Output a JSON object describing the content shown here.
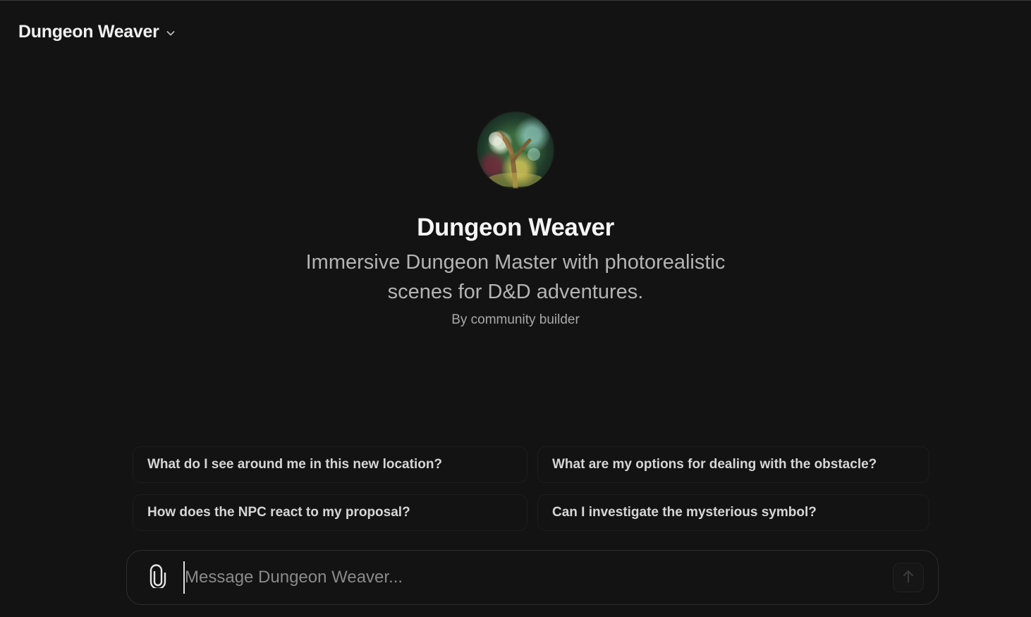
{
  "header": {
    "title": "Dungeon Weaver",
    "dropdown_icon": "chevron-down-icon"
  },
  "profile": {
    "avatar_icon": "gpt-avatar-image",
    "name": "Dungeon Weaver",
    "description": "Immersive Dungeon Master with photorealistic scenes for D&D adventures.",
    "author": "By community builder"
  },
  "suggestions": [
    "What do I see around me in this new location?",
    "What are my options for dealing with the obstacle?",
    "How does the NPC react to my proposal?",
    "Can I investigate the mysterious symbol?"
  ],
  "composer": {
    "placeholder": "Message Dungeon Weaver...",
    "value": "",
    "attach_icon": "paperclip-icon",
    "send_icon": "arrow-up-icon"
  },
  "colors": {
    "background": "#131313",
    "text_primary": "#f5f5f5",
    "text_secondary": "#b4b4b4"
  }
}
